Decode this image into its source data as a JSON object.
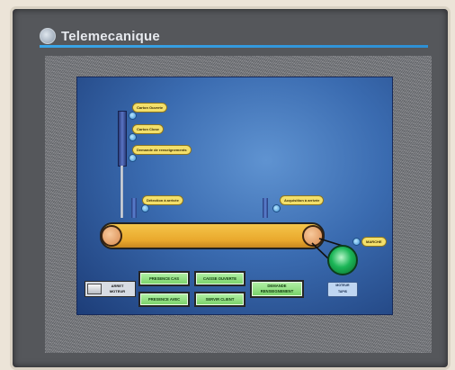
{
  "brand": {
    "name": "Telemecanique"
  },
  "screen": {
    "cylinder_tags": [
      "Carton Ouverte",
      "Carton Close",
      "Demande de renseignements"
    ],
    "sensor_tags": {
      "left": "Détection à arrivée",
      "right": "Acquisition à arrivée"
    },
    "motor": {
      "status_tag": "MARCHE",
      "label_line1": "MOTEUR",
      "label_line2": "TAPIS"
    },
    "toggle": {
      "line1": "ARRET",
      "line2": "MOTEUR"
    },
    "buttons": {
      "presence_cas": "PRESENCE CAS",
      "presence_avec": "PRESENCE AVEC",
      "caisse_ouverte": "CAISSE OUVERTE",
      "servir_client": "SERVIR CLIENT",
      "demande_line1": "DEMANDE",
      "demande_line2": "RENSEIGNEMENT"
    }
  },
  "colors": {
    "button_green": "#77d067",
    "tag_yellow": "#f3df6a",
    "belt_orange": "#e9a82c",
    "screen_blue": "#3a6bb0",
    "motor_green": "#1bb657",
    "brand_accent": "#2d8fd4"
  }
}
